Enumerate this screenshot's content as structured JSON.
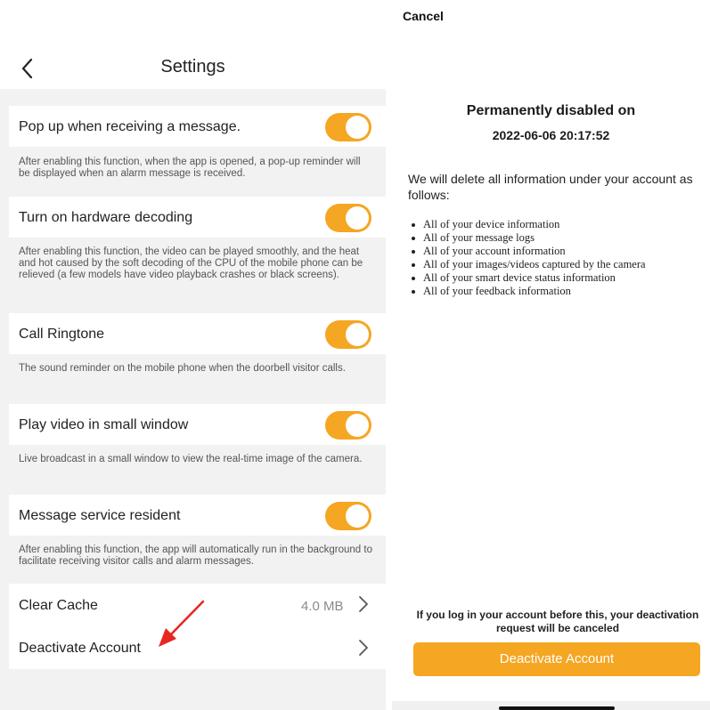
{
  "left": {
    "header": {
      "title": "Settings"
    },
    "settings": [
      {
        "label": "Pop up when receiving a message.",
        "enabled": true,
        "description": "After enabling this function, when the app is opened, a pop-up reminder will be displayed when an alarm message is received."
      },
      {
        "label": "Turn on hardware decoding",
        "enabled": true,
        "description": "After enabling this function, the video can be played smoothly, and the heat and hot caused by the soft decoding of the CPU of the mobile phone can be relieved (a few models have video playback crashes or black screens)."
      },
      {
        "label": "Call Ringtone",
        "enabled": true,
        "description": "The sound reminder on the mobile phone when the doorbell visitor calls."
      },
      {
        "label": "Play video in small window",
        "enabled": true,
        "description": "Live broadcast in a small window to view the real-time image of the camera."
      },
      {
        "label": "Message service resident",
        "enabled": true,
        "description": "After enabling this function, the app will automatically run in the background to facilitate receiving visitor calls and alarm messages."
      }
    ],
    "clear_cache": {
      "label": "Clear Cache",
      "value": "4.0 MB"
    },
    "deactivate": {
      "label": "Deactivate Account"
    }
  },
  "right": {
    "cancel_label": "Cancel",
    "title": "Permanently disabled on",
    "date": "2022-06-06 20:17:52",
    "intro": "We will delete all information under your account as follows:",
    "items": [
      "All of your device information",
      "All of your message logs",
      "All of your account information",
      "All of your images/videos captured by the camera",
      "All of your smart device status information",
      "All of your feedback information"
    ],
    "note": "If you log in your account before this, your deactivation request will be canceled",
    "button_label": "Deactivate Account"
  },
  "colors": {
    "accent": "#f5a623",
    "annotation_arrow": "#e8261f",
    "background": "#f2f2f2"
  }
}
